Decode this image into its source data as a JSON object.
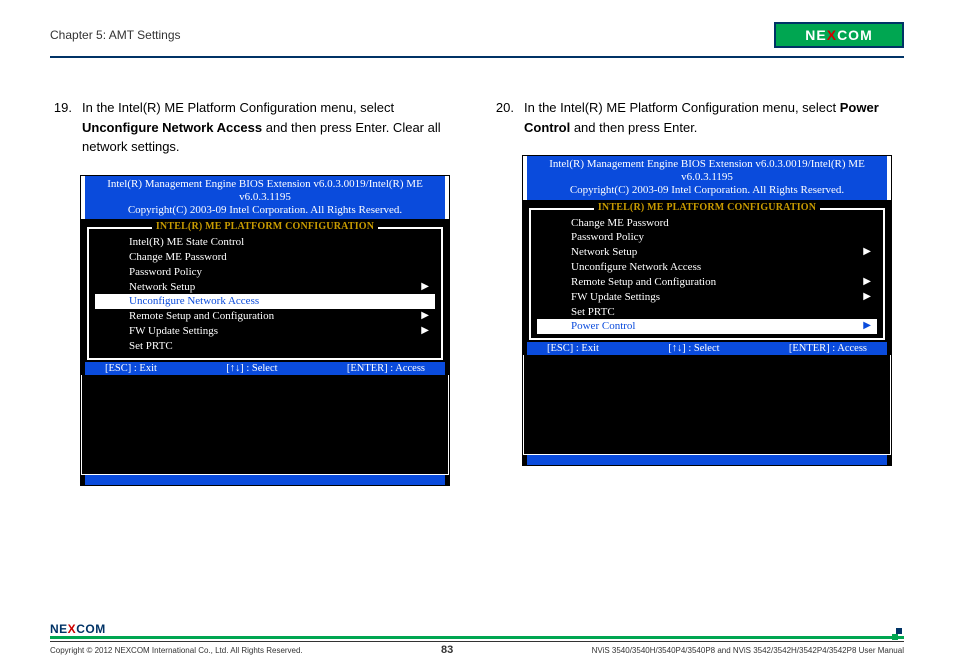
{
  "header": {
    "chapter": "Chapter 5: AMT Settings",
    "logo": "NEXCOM"
  },
  "steps": {
    "left": {
      "num": "19.",
      "pre": "In the Intel(R) ME Platform Configuration menu, select ",
      "bold": "Unconfigure Network Access",
      "post": " and then press Enter. Clear all network settings."
    },
    "right": {
      "num": "20.",
      "pre": "In the Intel(R) ME Platform Configuration menu, select ",
      "bold": "Power Control",
      "post": " and then press Enter."
    }
  },
  "bios": {
    "title1": "Intel(R) Management Engine BIOS Extension v6.0.3.0019/Intel(R) ME v6.0.3.1195",
    "title2": "Copyright(C) 2003-09 Intel Corporation. All Rights Reserved.",
    "section": "INTEL(R) ME PLATFORM CONFIGURATION",
    "nav": {
      "esc": "[ESC] : Exit",
      "sel": "[↑↓] : Select",
      "ent": "[ENTER] : Access"
    },
    "left_menu": [
      {
        "label": "Intel(R) ME State Control",
        "arrow": false,
        "selected": false
      },
      {
        "label": "Change ME Password",
        "arrow": false,
        "selected": false
      },
      {
        "label": "Password Policy",
        "arrow": false,
        "selected": false
      },
      {
        "label": "Network Setup",
        "arrow": true,
        "selected": false
      },
      {
        "label": "Unconfigure Network Access",
        "arrow": false,
        "selected": true
      },
      {
        "label": "Remote Setup and Configuration",
        "arrow": true,
        "selected": false
      },
      {
        "label": "FW Update Settings",
        "arrow": true,
        "selected": false
      },
      {
        "label": "Set PRTC",
        "arrow": false,
        "selected": false
      }
    ],
    "right_menu": [
      {
        "label": "Change ME Password",
        "arrow": false,
        "selected": false
      },
      {
        "label": "Password Policy",
        "arrow": false,
        "selected": false
      },
      {
        "label": "Network Setup",
        "arrow": true,
        "selected": false
      },
      {
        "label": "Unconfigure Network Access",
        "arrow": false,
        "selected": false
      },
      {
        "label": "Remote Setup and Configuration",
        "arrow": true,
        "selected": false
      },
      {
        "label": "FW Update Settings",
        "arrow": true,
        "selected": false
      },
      {
        "label": "Set PRTC",
        "arrow": false,
        "selected": false
      },
      {
        "label": "Power Control",
        "arrow": true,
        "selected": true
      }
    ]
  },
  "footer": {
    "copyright": "Copyright © 2012 NEXCOM International Co., Ltd. All Rights Reserved.",
    "page": "83",
    "manual": "NViS 3540/3540H/3540P4/3540P8 and NViS 3542/3542H/3542P4/3542P8 User Manual"
  }
}
